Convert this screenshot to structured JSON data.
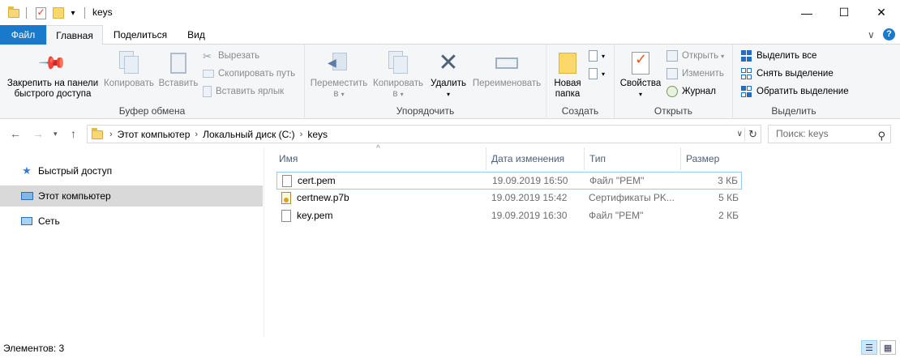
{
  "window": {
    "title": "keys",
    "minimize": "—",
    "maximize": "☐",
    "close": "✕"
  },
  "ribbon_tabs": {
    "file": "Файл",
    "home": "Главная",
    "share": "Поделиться",
    "view": "Вид",
    "collapse": "∨",
    "help": "?"
  },
  "ribbon": {
    "clipboard": {
      "label": "Буфер обмена",
      "pin": [
        "Закрепить на панели",
        "быстрого доступа"
      ],
      "copy": "Копировать",
      "paste": "Вставить",
      "cut": "Вырезать",
      "copy_path": "Скопировать путь",
      "paste_shortcut": "Вставить ярлык"
    },
    "organize": {
      "label": "Упорядочить",
      "move": [
        "Переместить",
        "в"
      ],
      "copy_to": [
        "Копировать",
        "в"
      ],
      "delete": "Удалить",
      "rename": "Переименовать"
    },
    "new": {
      "label": "Создать",
      "new_folder": [
        "Новая",
        "папка"
      ]
    },
    "open": {
      "label": "Открыть",
      "properties": "Свойства",
      "open": "Открыть",
      "edit": "Изменить",
      "history": "Журнал"
    },
    "select": {
      "label": "Выделить",
      "select_all": "Выделить все",
      "select_none": "Снять выделение",
      "invert": "Обратить выделение"
    }
  },
  "address": {
    "crumbs": [
      "Этот компьютер",
      "Локальный диск (C:)",
      "keys"
    ],
    "separator": "›",
    "search_placeholder": "Поиск: keys"
  },
  "nav_pane": {
    "items": [
      {
        "label": "Быстрый доступ",
        "icon": "star-icon"
      },
      {
        "label": "Этот компьютер",
        "icon": "computer-icon",
        "selected": true
      },
      {
        "label": "Сеть",
        "icon": "network-icon"
      }
    ]
  },
  "file_list": {
    "columns": [
      "Имя",
      "Дата изменения",
      "Тип",
      "Размер"
    ],
    "rows": [
      {
        "name": "cert.pem",
        "date": "19.09.2019 16:50",
        "type": "Файл \"PEM\"",
        "size": "3 КБ"
      },
      {
        "name": "certnew.p7b",
        "date": "19.09.2019 15:42",
        "type": "Сертификаты PK...",
        "size": "5 КБ"
      },
      {
        "name": "key.pem",
        "date": "19.09.2019 16:30",
        "type": "Файл \"PEM\"",
        "size": "2 КБ"
      }
    ]
  },
  "status": {
    "count": "Элементов: 3"
  },
  "colors": {
    "accent": "#1979ca",
    "ribbon_bg": "#f5f6f7",
    "selection": "#d9d9d9"
  }
}
